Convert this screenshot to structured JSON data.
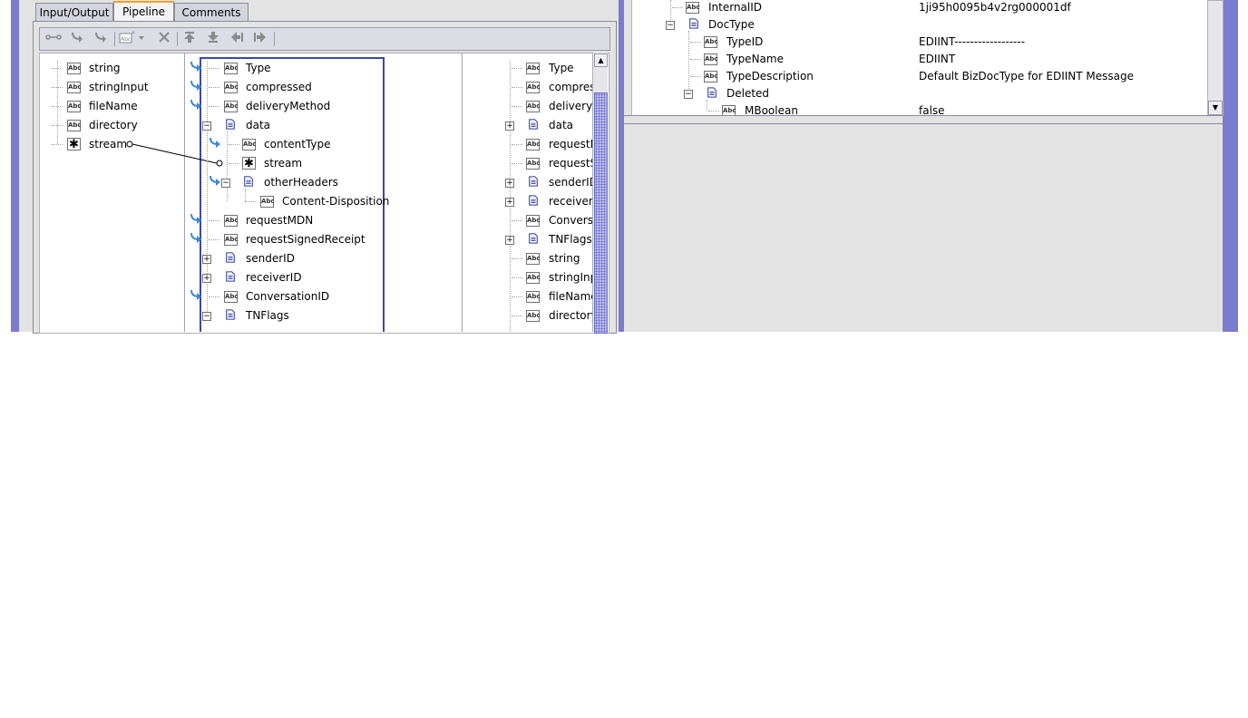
{
  "tabs": [
    {
      "label": "Input/Output",
      "active": false
    },
    {
      "label": "Pipeline",
      "active": true
    },
    {
      "label": "Comments",
      "active": false
    }
  ],
  "toolbar": {
    "buttons": [
      "link-icon",
      "map-forward-icon",
      "map-back-icon",
      "insert-field-icon",
      "delete-icon",
      "move-up-icon",
      "move-down-icon",
      "shift-left-icon",
      "shift-right-icon"
    ]
  },
  "pipeline_in": {
    "items": [
      {
        "label": "string",
        "icon": "abc-icon"
      },
      {
        "label": "stringInput",
        "icon": "abc-icon"
      },
      {
        "label": "fileName",
        "icon": "abc-icon"
      },
      {
        "label": "directory",
        "icon": "abc-icon"
      },
      {
        "label": "stream",
        "icon": "object-icon"
      }
    ]
  },
  "service_in": {
    "items": [
      {
        "label": "Type",
        "icon": "abc-icon"
      },
      {
        "label": "compressed",
        "icon": "abc-icon"
      },
      {
        "label": "deliveryMethod",
        "icon": "abc-icon"
      },
      {
        "label": "data",
        "icon": "document-icon"
      },
      {
        "label": "contentType",
        "icon": "abc-icon"
      },
      {
        "label": "stream",
        "icon": "object-icon"
      },
      {
        "label": "otherHeaders",
        "icon": "document-icon"
      },
      {
        "label": "Content-Disposition",
        "icon": "abc-icon"
      },
      {
        "label": "requestMDN",
        "icon": "abc-icon"
      },
      {
        "label": "requestSignedReceipt",
        "icon": "abc-icon"
      },
      {
        "label": "senderID",
        "icon": "document-icon"
      },
      {
        "label": "receiverID",
        "icon": "document-icon"
      },
      {
        "label": "ConversationID",
        "icon": "abc-icon"
      },
      {
        "label": "TNFlags",
        "icon": "document-icon"
      }
    ]
  },
  "pipeline_out": {
    "items": [
      {
        "label": "Type",
        "icon": "abc-icon"
      },
      {
        "label": "compres",
        "icon": "abc-icon"
      },
      {
        "label": "deliveryM",
        "icon": "abc-icon"
      },
      {
        "label": "data",
        "icon": "document-icon"
      },
      {
        "label": "requestM",
        "icon": "abc-icon"
      },
      {
        "label": "requestS",
        "icon": "abc-icon"
      },
      {
        "label": "senderID",
        "icon": "document-icon"
      },
      {
        "label": "receiverID",
        "icon": "document-icon"
      },
      {
        "label": "Conversa",
        "icon": "abc-icon"
      },
      {
        "label": "TNFlags",
        "icon": "document-icon"
      },
      {
        "label": "string",
        "icon": "abc-icon"
      },
      {
        "label": "stringInp",
        "icon": "abc-icon"
      },
      {
        "label": "fileName",
        "icon": "abc-icon"
      },
      {
        "label": "directory",
        "icon": "abc-icon"
      }
    ]
  },
  "results": {
    "rows": [
      {
        "name": "InternalID",
        "value": "1ji95h0095b4v2rg000001df",
        "icon": "abc-icon"
      },
      {
        "name": "DocType",
        "value": "",
        "icon": "document-icon"
      },
      {
        "name": "TypeID",
        "value": "EDIINT------------------",
        "icon": "abc-icon"
      },
      {
        "name": "TypeName",
        "value": "EDIINT",
        "icon": "abc-icon"
      },
      {
        "name": "TypeDescription",
        "value": "Default BizDocType for EDIINT Message",
        "icon": "abc-icon"
      },
      {
        "name": "Deleted",
        "value": "",
        "icon": "document-icon"
      },
      {
        "name": "MBoolean",
        "value": "false",
        "icon": "abc-icon"
      }
    ]
  },
  "colors": {
    "frame": "#7b7bd0",
    "panel": "#e3e3e3",
    "active_tab_accent": "#f0a030",
    "map_arrow": "#3a8ad8",
    "document_icon": "#2a3aa0"
  }
}
